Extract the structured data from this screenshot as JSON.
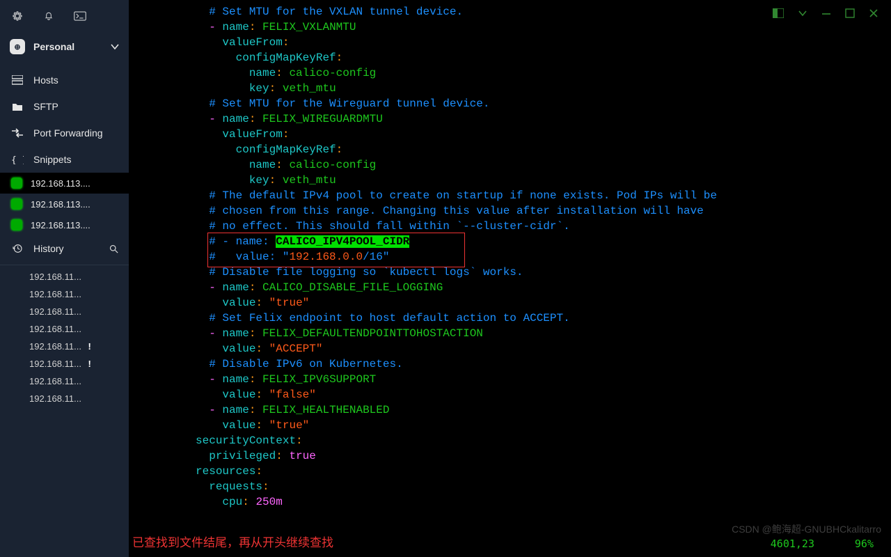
{
  "winctrl_icons": [
    "panel-icon",
    "chevron-down-icon",
    "minimize-icon",
    "maximize-icon",
    "close-icon"
  ],
  "sidebar": {
    "workspace_label": "Personal",
    "nav": [
      {
        "icon": "hosts-icon",
        "label": "Hosts"
      },
      {
        "icon": "folder-icon",
        "label": "SFTP"
      },
      {
        "icon": "port-fwd-icon",
        "label": "Port Forwarding"
      },
      {
        "icon": "snippets-icon",
        "label": "Snippets"
      }
    ],
    "sessions": [
      {
        "label": "192.168.113....",
        "active": true
      },
      {
        "label": "192.168.113....",
        "active": false
      },
      {
        "label": "192.168.113....",
        "active": false
      }
    ],
    "history_label": "History",
    "recent": [
      {
        "label": "192.168.11...",
        "warn": false
      },
      {
        "label": "192.168.11...",
        "warn": false
      },
      {
        "label": "192.168.11...",
        "warn": false
      },
      {
        "label": "192.168.11...",
        "warn": false
      },
      {
        "label": "192.168.11...",
        "warn": true
      },
      {
        "label": "192.168.11...",
        "warn": true
      },
      {
        "label": "192.168.11...",
        "warn": false
      },
      {
        "label": "192.168.11...",
        "warn": false
      }
    ]
  },
  "code": {
    "indent_base": "            ",
    "lines": [
      {
        "i": 0,
        "t": "comment",
        "text": "# Set MTU for the VXLAN tunnel device."
      },
      {
        "i": 0,
        "t": "kv-dash",
        "key": "name",
        "val": "FELIX_VXLANMTU"
      },
      {
        "i": 1,
        "t": "keyonly",
        "key": "valueFrom"
      },
      {
        "i": 2,
        "t": "keyonly",
        "key": "configMapKeyRef"
      },
      {
        "i": 3,
        "t": "kv",
        "key": "name",
        "val": "calico-config"
      },
      {
        "i": 3,
        "t": "kv",
        "key": "key",
        "val": "veth_mtu"
      },
      {
        "i": 0,
        "t": "comment",
        "text": "# Set MTU for the Wireguard tunnel device."
      },
      {
        "i": 0,
        "t": "kv-dash",
        "key": "name",
        "val": "FELIX_WIREGUARDMTU"
      },
      {
        "i": 1,
        "t": "keyonly",
        "key": "valueFrom"
      },
      {
        "i": 2,
        "t": "keyonly",
        "key": "configMapKeyRef"
      },
      {
        "i": 3,
        "t": "kv",
        "key": "name",
        "val": "calico-config"
      },
      {
        "i": 3,
        "t": "kv",
        "key": "key",
        "val": "veth_mtu"
      },
      {
        "i": 0,
        "t": "comment",
        "text": "# The default IPv4 pool to create on startup if none exists. Pod IPs will be"
      },
      {
        "i": 0,
        "t": "comment",
        "text": "# chosen from this range. Changing this value after installation will have"
      },
      {
        "i": 0,
        "t": "comment",
        "text": "# no effect. This should fall within `--cluster-cidr`."
      },
      {
        "i": 0,
        "t": "comment-cidr1"
      },
      {
        "i": 0,
        "t": "comment-cidr2"
      },
      {
        "i": 0,
        "t": "comment",
        "text": "# Disable file logging so `kubectl logs` works."
      },
      {
        "i": 0,
        "t": "kv-dash",
        "key": "name",
        "val": "CALICO_DISABLE_FILE_LOGGING"
      },
      {
        "i": 1,
        "t": "kv-str",
        "key": "value",
        "val": "\"true\""
      },
      {
        "i": 0,
        "t": "comment",
        "text": "# Set Felix endpoint to host default action to ACCEPT."
      },
      {
        "i": 0,
        "t": "kv-dash",
        "key": "name",
        "val": "FELIX_DEFAULTENDPOINTTOHOSTACTION"
      },
      {
        "i": 1,
        "t": "kv-str",
        "key": "value",
        "val": "\"ACCEPT\""
      },
      {
        "i": 0,
        "t": "comment",
        "text": "# Disable IPv6 on Kubernetes."
      },
      {
        "i": 0,
        "t": "kv-dash",
        "key": "name",
        "val": "FELIX_IPV6SUPPORT"
      },
      {
        "i": 1,
        "t": "kv-str",
        "key": "value",
        "val": "\"false\""
      },
      {
        "i": 0,
        "t": "kv-dash",
        "key": "name",
        "val": "FELIX_HEALTHENABLED"
      },
      {
        "i": 1,
        "t": "kv-str",
        "key": "value",
        "val": "\"true\""
      },
      {
        "i": -1,
        "t": "keyonly",
        "key": "securityContext"
      },
      {
        "i": 0,
        "t": "kv-bool",
        "key": "privileged",
        "val": "true"
      },
      {
        "i": -1,
        "t": "keyonly",
        "key": "resources"
      },
      {
        "i": 0,
        "t": "keyonly",
        "key": "requests"
      },
      {
        "i": 1,
        "t": "kv-num",
        "key": "cpu",
        "val": "250m"
      }
    ],
    "cidr": {
      "prefix1": "# - name: ",
      "highlight": "CALICO_IPV4POOL_CIDR",
      "prefix2": "#   value: \"",
      "ip": "192.168.0.0",
      "mask": "/16",
      "suffix2": "\""
    }
  },
  "status": {
    "msg": "已查找到文件结尾，再从开头继续查找",
    "pos": "4601,23",
    "pct": "96%"
  },
  "watermark": "CSDN @鲍海超-GNUBHCkalitarro"
}
